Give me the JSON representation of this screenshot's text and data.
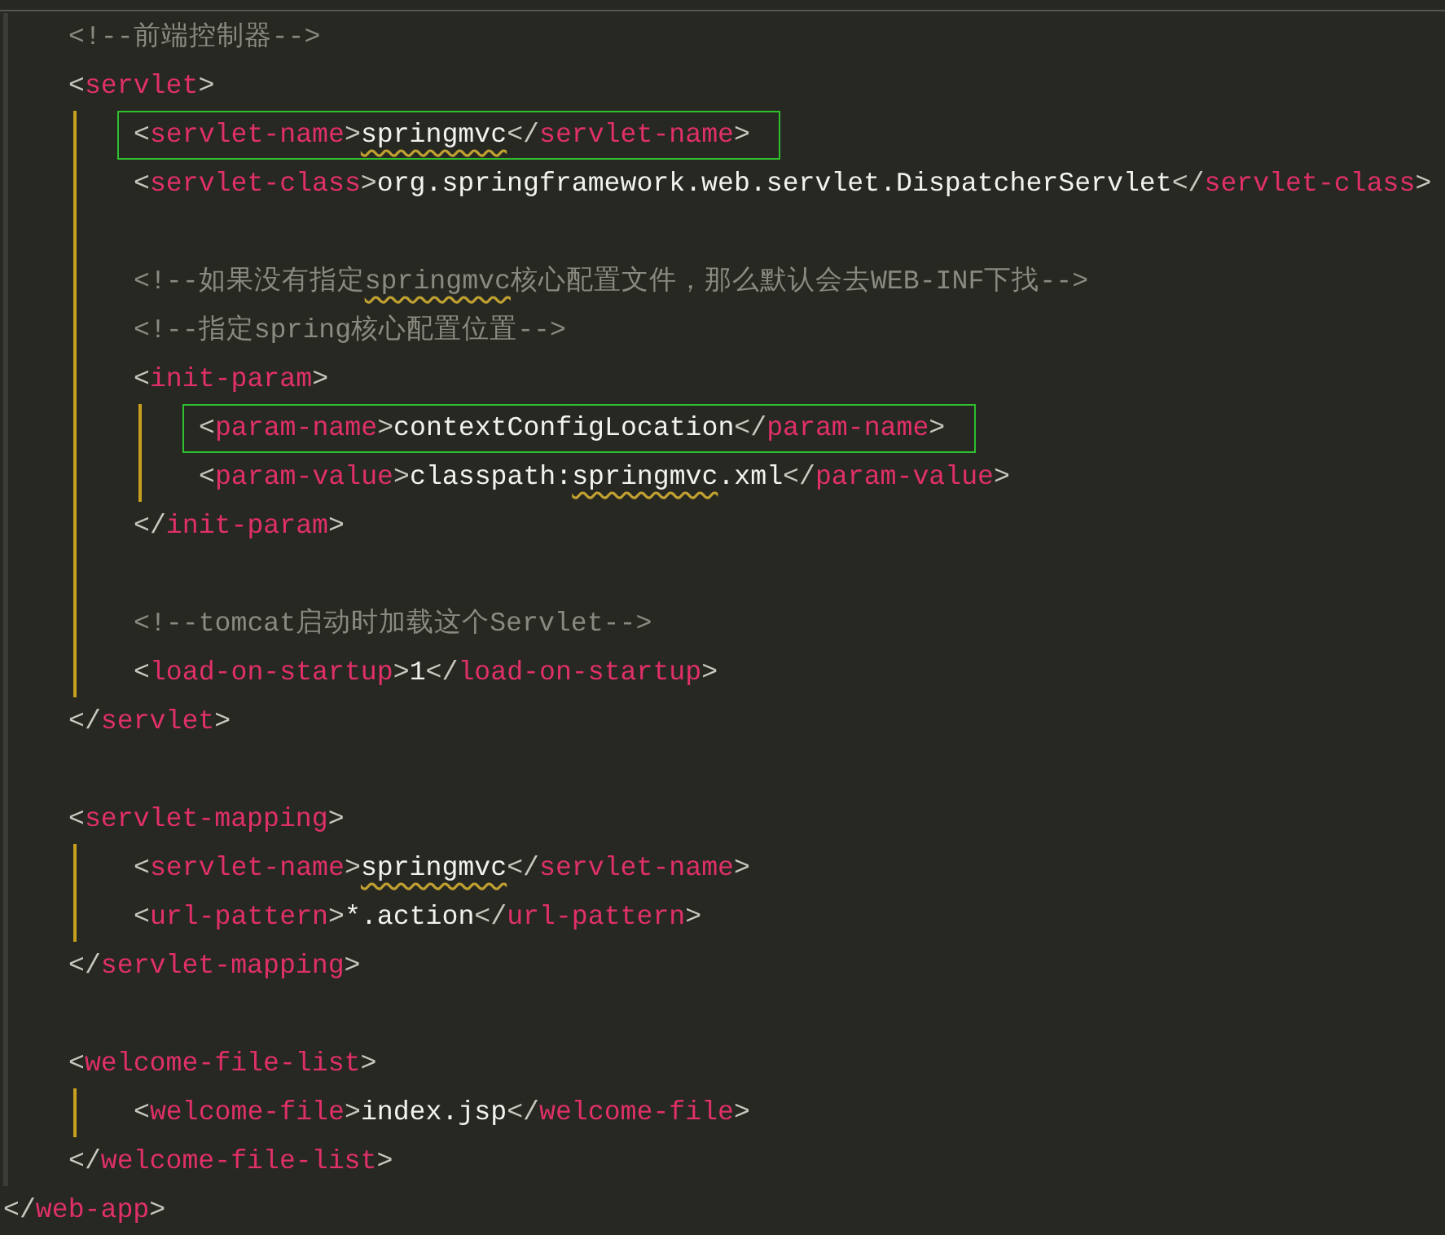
{
  "editor": {
    "children": [
      {
        "kind": "code",
        "tokens": [
          {
            "kind": "comment",
            "text": "<!--前端控制器-->"
          }
        ]
      },
      {
        "kind": "code",
        "tokens": [
          {
            "kind": "punct",
            "text": "<"
          },
          {
            "kind": "tag",
            "text": "servlet"
          },
          {
            "kind": "punct",
            "text": ">"
          }
        ],
        "children": [
          {
            "kind": "code",
            "highlighted": true,
            "tokens": [
              {
                "kind": "punct",
                "text": "<"
              },
              {
                "kind": "tag",
                "text": "servlet-name"
              },
              {
                "kind": "punct",
                "text": ">"
              },
              {
                "kind": "text",
                "text": "springmvc",
                "flagged": true
              },
              {
                "kind": "punct",
                "text": "</"
              },
              {
                "kind": "tag",
                "text": "servlet-name"
              },
              {
                "kind": "punct",
                "text": ">"
              }
            ]
          },
          {
            "kind": "code",
            "tokens": [
              {
                "kind": "punct",
                "text": "<"
              },
              {
                "kind": "tag",
                "text": "servlet-class"
              },
              {
                "kind": "punct",
                "text": ">"
              },
              {
                "kind": "text",
                "text": "org.springframework.web.servlet.DispatcherServlet"
              },
              {
                "kind": "punct",
                "text": "</"
              },
              {
                "kind": "tag",
                "text": "servlet-class"
              },
              {
                "kind": "punct",
                "text": ">"
              }
            ]
          },
          {
            "kind": "blank"
          },
          {
            "kind": "code",
            "tokens": [
              {
                "kind": "comment",
                "text": "<!--如果没有指定"
              },
              {
                "kind": "comment",
                "text": "springmvc",
                "flagged": true
              },
              {
                "kind": "comment",
                "text": "核心配置文件，那么默认会去WEB-INF下找-->"
              }
            ]
          },
          {
            "kind": "code",
            "tokens": [
              {
                "kind": "comment",
                "text": "<!--指定spring核心配置位置-->"
              }
            ]
          },
          {
            "kind": "code",
            "tokens": [
              {
                "kind": "punct",
                "text": "<"
              },
              {
                "kind": "tag",
                "text": "init-param"
              },
              {
                "kind": "punct",
                "text": ">"
              }
            ],
            "children": [
              {
                "kind": "code",
                "highlighted": true,
                "tokens": [
                  {
                    "kind": "punct",
                    "text": "<"
                  },
                  {
                    "kind": "tag",
                    "text": "param-name"
                  },
                  {
                    "kind": "punct",
                    "text": ">"
                  },
                  {
                    "kind": "text",
                    "text": "contextConfigLocation"
                  },
                  {
                    "kind": "punct",
                    "text": "</"
                  },
                  {
                    "kind": "tag",
                    "text": "param-name"
                  },
                  {
                    "kind": "punct",
                    "text": ">"
                  }
                ]
              },
              {
                "kind": "code",
                "tokens": [
                  {
                    "kind": "punct",
                    "text": "<"
                  },
                  {
                    "kind": "tag",
                    "text": "param-value"
                  },
                  {
                    "kind": "punct",
                    "text": ">"
                  },
                  {
                    "kind": "text",
                    "text": "classpath:"
                  },
                  {
                    "kind": "text",
                    "text": "springmvc",
                    "flagged": true
                  },
                  {
                    "kind": "text",
                    "text": ".xml"
                  },
                  {
                    "kind": "punct",
                    "text": "</"
                  },
                  {
                    "kind": "tag",
                    "text": "param-value"
                  },
                  {
                    "kind": "punct",
                    "text": ">"
                  }
                ]
              }
            ],
            "close": [
              {
                "kind": "punct",
                "text": "</"
              },
              {
                "kind": "tag",
                "text": "init-param"
              },
              {
                "kind": "punct",
                "text": ">"
              }
            ]
          },
          {
            "kind": "blank"
          },
          {
            "kind": "code",
            "tokens": [
              {
                "kind": "comment",
                "text": "<!--tomcat启动时加载这个Servlet-->"
              }
            ]
          },
          {
            "kind": "code",
            "tokens": [
              {
                "kind": "punct",
                "text": "<"
              },
              {
                "kind": "tag",
                "text": "load-on-startup"
              },
              {
                "kind": "punct",
                "text": ">"
              },
              {
                "kind": "text",
                "text": "1"
              },
              {
                "kind": "punct",
                "text": "</"
              },
              {
                "kind": "tag",
                "text": "load-on-startup"
              },
              {
                "kind": "punct",
                "text": ">"
              }
            ]
          }
        ],
        "close": [
          {
            "kind": "punct",
            "text": "</"
          },
          {
            "kind": "tag",
            "text": "servlet"
          },
          {
            "kind": "punct",
            "text": ">"
          }
        ]
      },
      {
        "kind": "blank"
      },
      {
        "kind": "code",
        "tokens": [
          {
            "kind": "punct",
            "text": "<"
          },
          {
            "kind": "tag",
            "text": "servlet-mapping"
          },
          {
            "kind": "punct",
            "text": ">"
          }
        ],
        "children": [
          {
            "kind": "code",
            "tokens": [
              {
                "kind": "punct",
                "text": "<"
              },
              {
                "kind": "tag",
                "text": "servlet-name"
              },
              {
                "kind": "punct",
                "text": ">"
              },
              {
                "kind": "text",
                "text": "springmvc",
                "flagged": true
              },
              {
                "kind": "punct",
                "text": "</"
              },
              {
                "kind": "tag",
                "text": "servlet-name"
              },
              {
                "kind": "punct",
                "text": ">"
              }
            ]
          },
          {
            "kind": "code",
            "tokens": [
              {
                "kind": "punct",
                "text": "<"
              },
              {
                "kind": "tag",
                "text": "url-pattern"
              },
              {
                "kind": "punct",
                "text": ">"
              },
              {
                "kind": "text",
                "text": "*.action"
              },
              {
                "kind": "punct",
                "text": "</"
              },
              {
                "kind": "tag",
                "text": "url-pattern"
              },
              {
                "kind": "punct",
                "text": ">"
              }
            ]
          }
        ],
        "close": [
          {
            "kind": "punct",
            "text": "</"
          },
          {
            "kind": "tag",
            "text": "servlet-mapping"
          },
          {
            "kind": "punct",
            "text": ">"
          }
        ]
      },
      {
        "kind": "blank"
      },
      {
        "kind": "code",
        "tokens": [
          {
            "kind": "punct",
            "text": "<"
          },
          {
            "kind": "tag",
            "text": "welcome-file-list"
          },
          {
            "kind": "punct",
            "text": ">"
          }
        ],
        "children": [
          {
            "kind": "code",
            "tokens": [
              {
                "kind": "punct",
                "text": "<"
              },
              {
                "kind": "tag",
                "text": "welcome-file"
              },
              {
                "kind": "punct",
                "text": ">"
              },
              {
                "kind": "text",
                "text": "index.jsp"
              },
              {
                "kind": "punct",
                "text": "</"
              },
              {
                "kind": "tag",
                "text": "welcome-file"
              },
              {
                "kind": "punct",
                "text": ">"
              }
            ]
          }
        ],
        "close": [
          {
            "kind": "punct",
            "text": "</"
          },
          {
            "kind": "tag",
            "text": "welcome-file-list"
          },
          {
            "kind": "punct",
            "text": ">"
          }
        ]
      }
    ],
    "close": [
      {
        "kind": "punct",
        "text": "</"
      },
      {
        "kind": "tag",
        "text": "web-app"
      },
      {
        "kind": "punct",
        "text": ">"
      }
    ]
  }
}
